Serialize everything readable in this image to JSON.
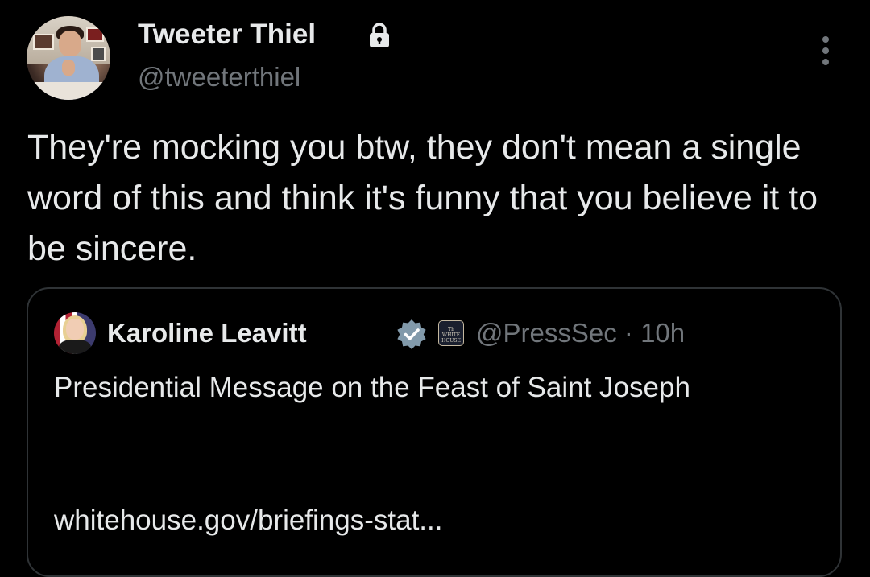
{
  "tweet": {
    "author": {
      "display_name": "Tweeter Thiel",
      "handle": "@tweeterthiel",
      "protected_icon": "lock-icon"
    },
    "more_icon": "more-vertical-icon",
    "text": "They're mocking you btw, they don't mean a single word of this and think it's funny that you believe it to be sincere."
  },
  "quote": {
    "author": {
      "display_name": "Karoline Leavitt",
      "verified_icon": "verified-badge-icon",
      "affiliate_badge_icon": "white-house-badge-icon",
      "handle": "@PressSec",
      "separator": "·",
      "time": "10h"
    },
    "text": "Presidential Message on the Feast of Saint Joseph",
    "link": "whitehouse.gov/briefings-stat..."
  },
  "colors": {
    "background": "#000000",
    "primary_text": "#e7e9ea",
    "secondary_text": "#71767b",
    "border": "#2f3336",
    "verified_gray": "#829aab"
  }
}
